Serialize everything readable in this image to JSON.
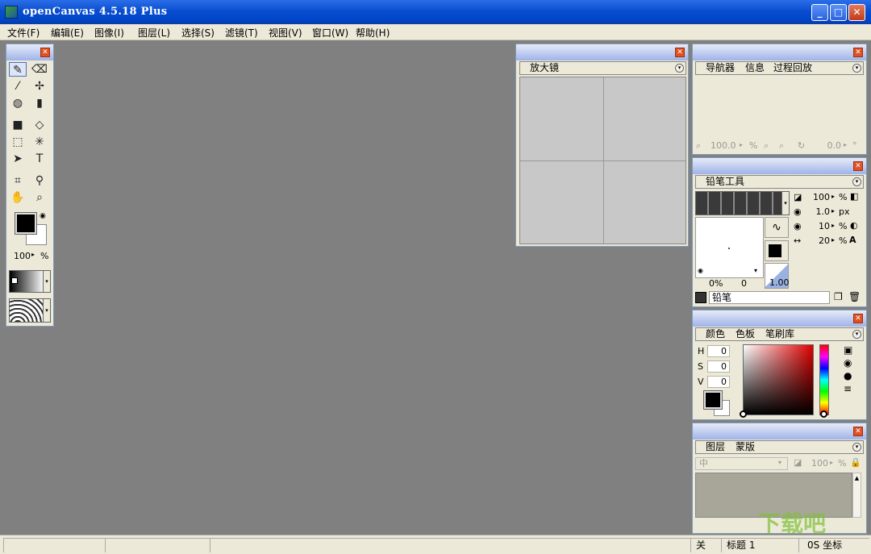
{
  "window": {
    "title": "openCanvas 4.5.18 Plus",
    "minimize": "_",
    "maximize": "□",
    "close": "✕"
  },
  "menu": [
    "文件(F)",
    "编辑(E)",
    "图像(I)",
    "图层(L)",
    "选择(S)",
    "滤镜(T)",
    "视图(V)",
    "窗口(W)",
    "帮助(H)"
  ],
  "toolbox": {
    "zoom_value": "100",
    "zoom_unit": "%",
    "close": "✕"
  },
  "magnifier": {
    "tab": "放大镜",
    "close": "✕"
  },
  "navigator": {
    "tabs": [
      "导航器",
      "信息",
      "过程回放"
    ],
    "zoom_value": "100.0",
    "zoom_unit": "%",
    "rotate_value": "0.0",
    "rotate_unit": "°",
    "close": "✕"
  },
  "pencil_tool": {
    "tab": "铅笔工具",
    "opacity": "100",
    "opacity_unit": "%",
    "size": "1.0",
    "size_unit": "px",
    "hardness": "10",
    "hardness_unit": "%",
    "spacing": "20",
    "spacing_unit": "%",
    "pressure_min": "0%",
    "pressure_min2": "0",
    "curve_value": "1.00",
    "preset_name": "铅笔",
    "close": "✕"
  },
  "color_panel": {
    "tabs": [
      "颜色",
      "色板",
      "笔刷库"
    ],
    "h_label": "H",
    "h_value": "0",
    "s_label": "S",
    "s_value": "0",
    "v_label": "V",
    "v_value": "0",
    "close": "✕"
  },
  "layer_panel": {
    "tabs": [
      "图层",
      "蒙版"
    ],
    "blend_mode": "中",
    "opacity": "100",
    "opacity_unit": "%",
    "close": "✕"
  },
  "status": {
    "cell1": "关",
    "cell2": "标题 1",
    "cell3": "0S 坐标"
  },
  "watermark": "下载吧 www.xiazaiba.com",
  "colors": {
    "titlebar": "#0a4ed0",
    "panel_bg": "#ece9d8",
    "canvas_bg": "#808080",
    "panel_header": "#9fb3e9"
  }
}
